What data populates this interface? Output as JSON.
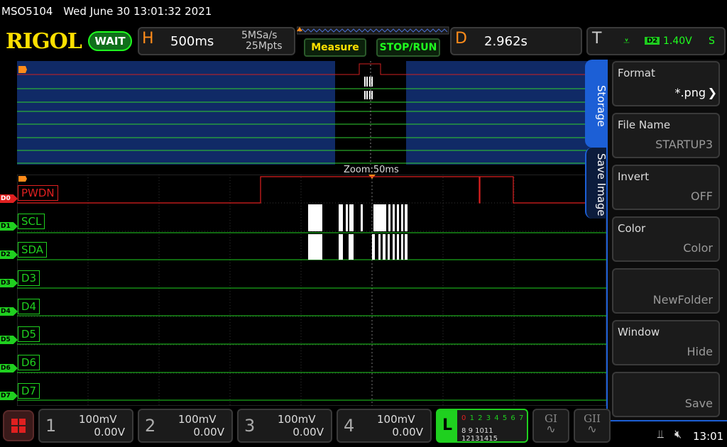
{
  "top_bar": {
    "model": "MSO5104",
    "datetime": "Wed June 30 13:01:32 2021"
  },
  "logo": "RIGOL",
  "status": "WAIT",
  "horizontal": {
    "letter": "H",
    "time_div": "500ms",
    "sample_rate": "5MSa/s",
    "memory_depth": "25Mpts"
  },
  "buttons": {
    "measure": "Measure",
    "stop_run": "STOP/RUN"
  },
  "delay": {
    "letter": "D",
    "value": "2.962s"
  },
  "trigger": {
    "letter": "T",
    "source": "D2",
    "level": "1.40V",
    "mode": "S"
  },
  "zoom_label": "Zoom:50ms",
  "side_tabs": {
    "storage": "Storage",
    "save_image": "Save Image"
  },
  "menu": [
    {
      "title": "Format",
      "value": "*.png"
    },
    {
      "title": "File Name",
      "value": "STARTUP3"
    },
    {
      "title": "Invert",
      "value": "OFF"
    },
    {
      "title": "Color",
      "value": "Color"
    },
    {
      "title": "",
      "value": "NewFolder"
    },
    {
      "title": "Window",
      "value": "Hide"
    },
    {
      "title": "",
      "value": "Save"
    }
  ],
  "channels": [
    {
      "tag": "D0",
      "label": "PWDN"
    },
    {
      "tag": "D1",
      "label": "SCL"
    },
    {
      "tag": "D2",
      "label": "SDA"
    },
    {
      "tag": "D3",
      "label": "D3"
    },
    {
      "tag": "D4",
      "label": "D4"
    },
    {
      "tag": "D5",
      "label": "D5"
    },
    {
      "tag": "D6",
      "label": "D6"
    },
    {
      "tag": "D7",
      "label": "D7"
    }
  ],
  "analog": [
    {
      "num": "1",
      "scale": "100mV",
      "offset": "0.00V"
    },
    {
      "num": "2",
      "scale": "100mV",
      "offset": "0.00V"
    },
    {
      "num": "3",
      "scale": "100mV",
      "offset": "0.00V"
    },
    {
      "num": "4",
      "scale": "100mV",
      "offset": "0.00V"
    }
  ],
  "la": {
    "letter": "L",
    "row1": [
      "0",
      "1",
      "2",
      "3",
      "4",
      "5",
      "6",
      "7"
    ],
    "row2": [
      "8",
      "9",
      "10",
      "11",
      "12",
      "13",
      "14",
      "15"
    ]
  },
  "gen": {
    "g1": "GI",
    "g2": "GII"
  },
  "clock": "13:01",
  "colors": {
    "accent_orange": "#ff8c1a",
    "trace_green": "#22dd22",
    "pwdn_red": "#e02020",
    "tab_blue": "#1c5fd6"
  }
}
